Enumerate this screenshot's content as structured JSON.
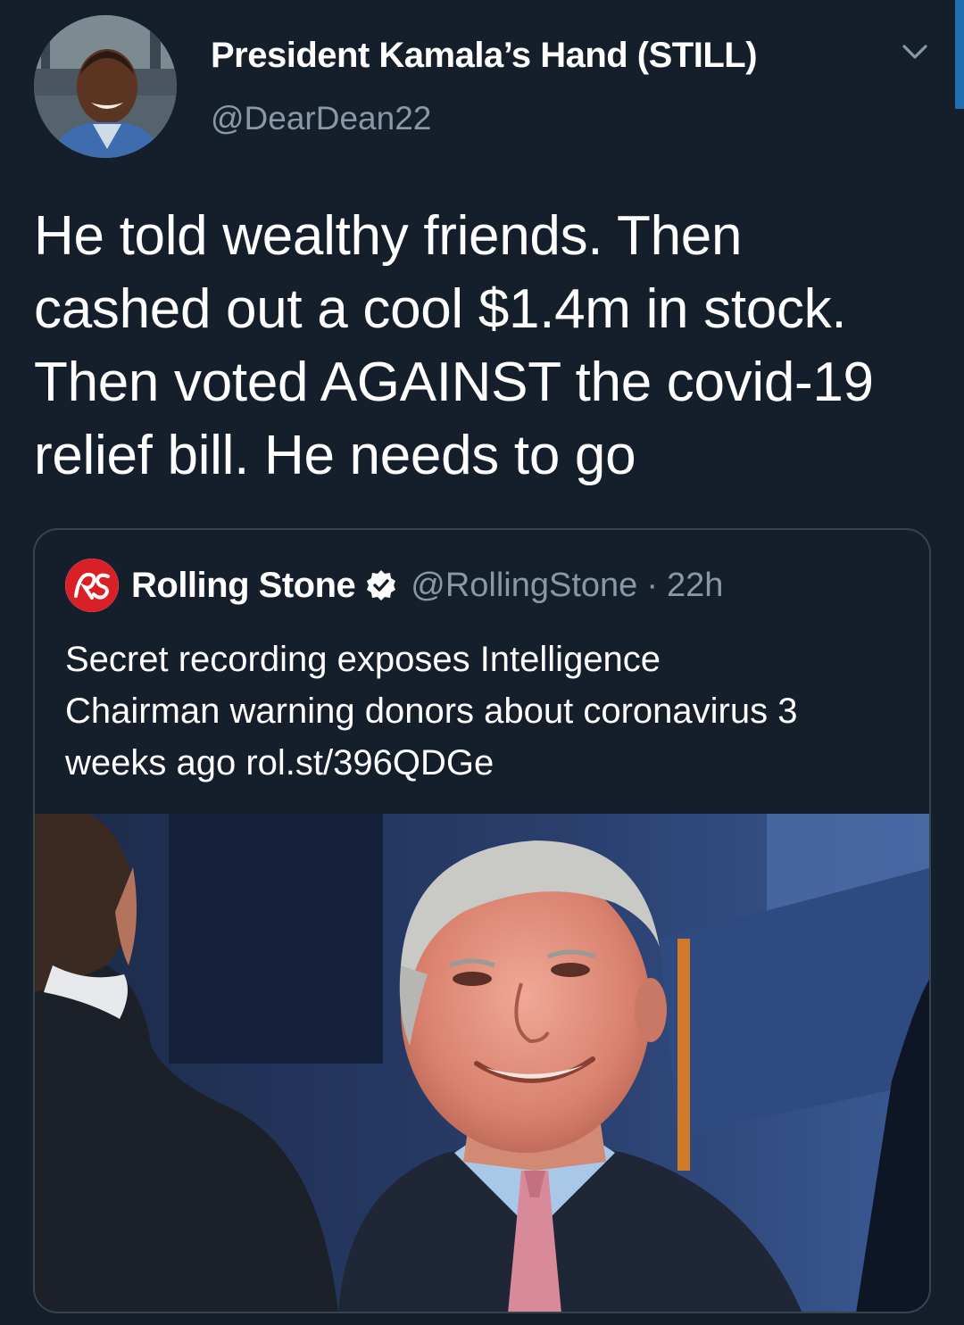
{
  "tweet": {
    "author_name": "President Kamala’s Hand (STILL)",
    "author_handle": "@DearDean22",
    "text_lines": [
      "He told wealthy friends. Then",
      "cashed out a cool $1.4m in stock.",
      "Then voted AGAINST the covid-19",
      "relief bill. He needs to go"
    ],
    "menu_icon": "chevron-down-icon",
    "avatar": "profile-photo"
  },
  "quoted_tweet": {
    "name": "Rolling Stone",
    "logo_icon": "rolling-stone-logo",
    "verified_icon": "verified-badge-icon",
    "handle": "@RollingStone",
    "separator": "·",
    "time": "22h",
    "text_lines": [
      "Secret recording exposes Intelligence",
      "Chairman warning donors about coronavirus 3",
      "weeks ago rol.st/396QDGe"
    ],
    "image": "photo-of-smiling-man-in-suit"
  },
  "colors": {
    "background": "#151f2b",
    "text": "#ffffff",
    "secondary_text": "#8899a6",
    "border": "#38444d",
    "accent": "#1f6fb2",
    "logo_red": "#d92027"
  }
}
